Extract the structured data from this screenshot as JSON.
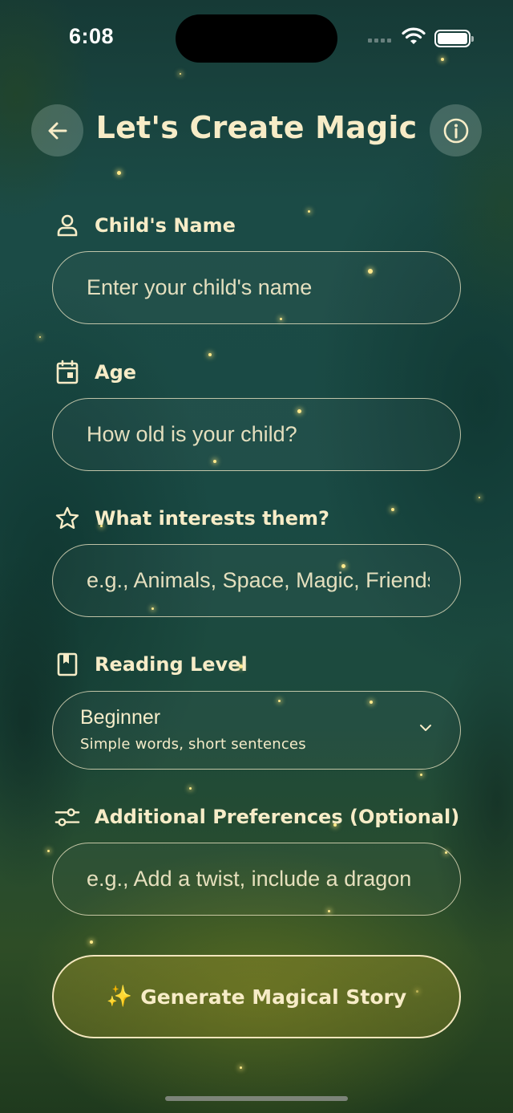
{
  "status_bar": {
    "time": "6:08"
  },
  "header": {
    "title": "Let's Create Magic",
    "back_icon": "arrow-left-icon",
    "info_icon": "info-circle-icon"
  },
  "form": {
    "name": {
      "label": "Child's Name",
      "icon": "person-icon",
      "placeholder": "Enter your child's name",
      "value": ""
    },
    "age": {
      "label": "Age",
      "icon": "calendar-icon",
      "placeholder": "How old is your child?",
      "value": ""
    },
    "interests": {
      "label": "What interests them?",
      "icon": "star-icon",
      "placeholder": "e.g., Animals, Space, Magic, Friendship",
      "value": ""
    },
    "reading_level": {
      "label": "Reading Level",
      "icon": "book-icon",
      "selected": "Beginner",
      "description": "Simple words, short sentences",
      "dropdown_icon": "chevron-down-icon"
    },
    "preferences": {
      "label": "Additional Preferences (Optional)",
      "icon": "sliders-icon",
      "placeholder": "e.g., Add a twist, include a dragon",
      "value": ""
    }
  },
  "generate_button": {
    "emoji": "✨",
    "label": "Generate Magical Story"
  },
  "colors": {
    "text": "#f7ecc7",
    "background_top": "#163a36",
    "background_bottom": "#2e4d26",
    "sparkle": "#ffe98a"
  }
}
